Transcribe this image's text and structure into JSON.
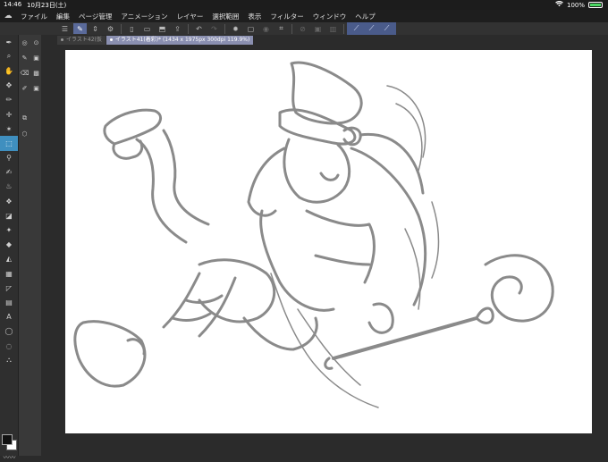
{
  "status": {
    "time": "14:46",
    "date": "10月23日(土)",
    "battery": "100%",
    "wifi_icon": "wifi-icon",
    "battery_icon": "battery-icon"
  },
  "menu": {
    "items": [
      "ファイル",
      "編集",
      "ページ管理",
      "アニメーション",
      "レイヤー",
      "選択範囲",
      "表示",
      "フィルター",
      "ウィンドウ",
      "ヘルプ"
    ]
  },
  "tabs": [
    {
      "label": "イラスト42(仮"
    },
    {
      "label": "イラスト41(着彩)* (1434 x 1975px 300dpi 119.9%)"
    }
  ],
  "colors": {
    "accent": "#4a5b8a",
    "active_tool": "#3f8fbf",
    "canvas": "#ffffff",
    "sketch_stroke": "#8a8a8a"
  },
  "strokes_label": "〰〰"
}
